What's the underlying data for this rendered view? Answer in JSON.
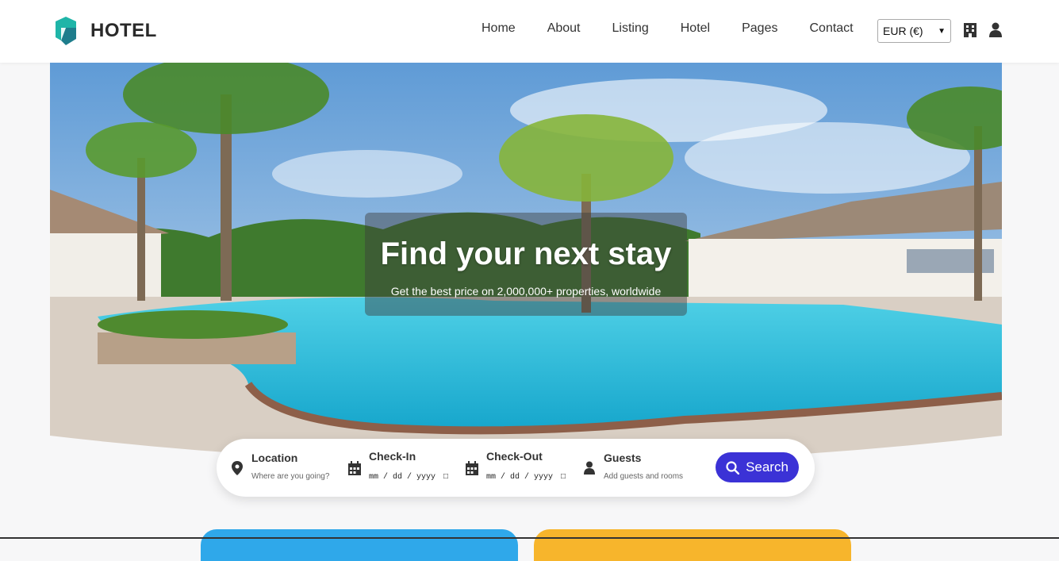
{
  "brand": {
    "name": "HOTEL",
    "logo_colors": [
      "#1fb5a8",
      "#1e7d8c"
    ]
  },
  "nav": {
    "items": [
      {
        "label": "Home"
      },
      {
        "label": "About"
      },
      {
        "label": "Listing"
      },
      {
        "label": "Hotel"
      },
      {
        "label": "Pages"
      },
      {
        "label": "Contact"
      }
    ]
  },
  "header": {
    "currency": "EUR (€)",
    "icons": [
      "building-icon",
      "user-icon"
    ]
  },
  "hero": {
    "title": "Find your next stay",
    "subtitle": "Get the best price on 2,000,000+ properties, worldwide"
  },
  "search": {
    "location": {
      "label": "Location",
      "placeholder": "Where are you going?",
      "icon": "map-pin-icon"
    },
    "checkin": {
      "label": "Check-In",
      "value": "mm / dd / yyyy",
      "icon": "calendar-icon"
    },
    "checkout": {
      "label": "Check-Out",
      "value": "mm / dd / yyyy",
      "icon": "calendar-icon"
    },
    "guests": {
      "label": "Guests",
      "placeholder": "Add guests and rooms",
      "icon": "user-icon"
    },
    "button": "Search",
    "button_color": "#3b32d6"
  },
  "colors": {
    "card_left": "#2fa8ea",
    "card_right": "#f7b52c"
  }
}
